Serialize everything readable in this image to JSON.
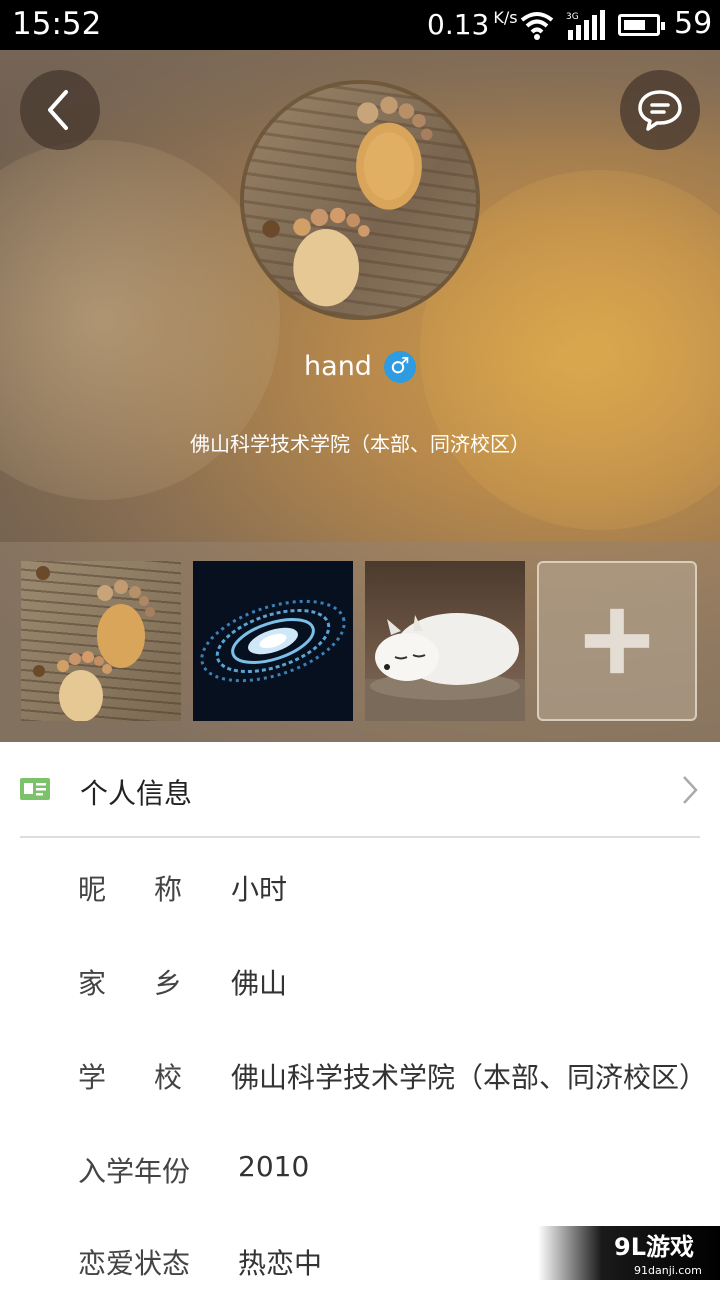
{
  "status_bar": {
    "time": "15:52",
    "net_speed": "0.13",
    "net_unit": "K/s",
    "network": "3G",
    "battery_level": 59,
    "battery_text": "59"
  },
  "profile": {
    "username": "hand",
    "gender_symbol": "♂",
    "school_line": "佛山科学技术学院（本部、同济校区）",
    "photos": [
      "footprints-photo",
      "galaxy-photo",
      "arctic-fox-photo"
    ]
  },
  "section": {
    "title": "个人信息"
  },
  "info": [
    {
      "label": "昵称",
      "value": "小时"
    },
    {
      "label": "家乡",
      "value": "佛山"
    },
    {
      "label": "学校",
      "value": "佛山科学技术学院（本部、同济校区）"
    },
    {
      "label": "入学年份",
      "value": "2010"
    },
    {
      "label": "恋爱状态",
      "value": "热恋中"
    }
  ],
  "watermark": {
    "brand": "9L游戏",
    "site": "91danji.com"
  },
  "colors": {
    "accent_green": "#7cc26a",
    "gender_blue": "#2f9be0"
  }
}
